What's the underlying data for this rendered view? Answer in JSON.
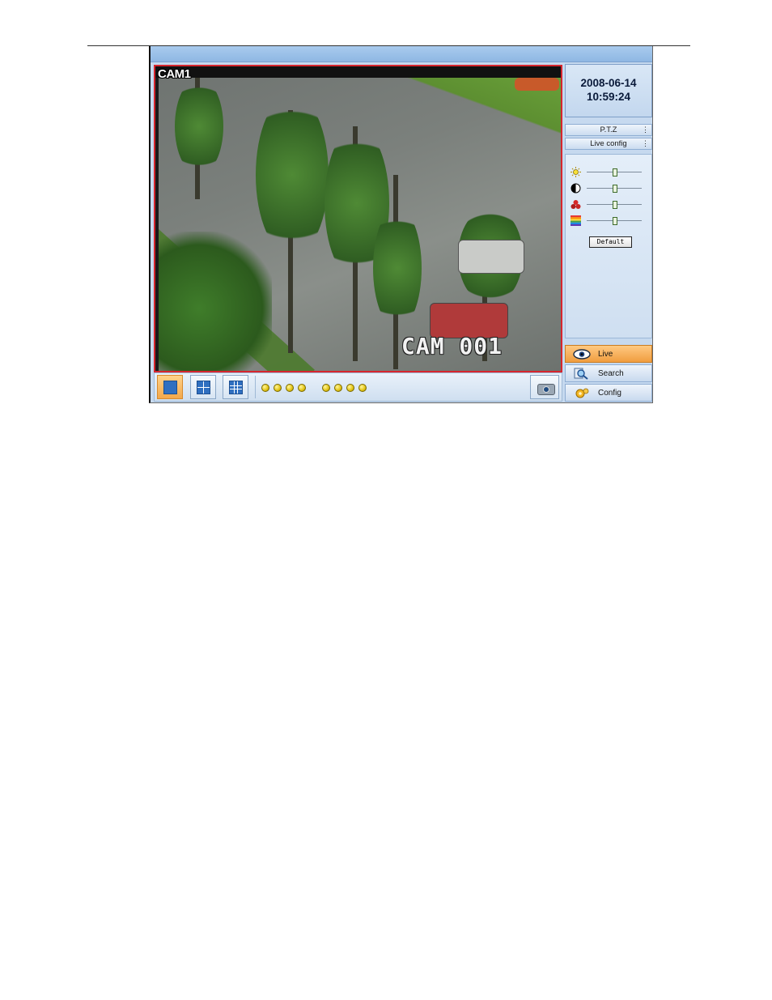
{
  "app": {
    "camera_name": "CAM1",
    "osd_text": "CAM 001",
    "datetime": {
      "date": "2008-06-14",
      "time": "10:59:24"
    },
    "tabs": [
      {
        "label": "P.T.Z"
      },
      {
        "label": "Live config"
      }
    ],
    "adjustments": [
      {
        "name": "brightness",
        "icon": "sun-icon",
        "value": 0.5
      },
      {
        "name": "contrast",
        "icon": "contrast-icon",
        "value": 0.5
      },
      {
        "name": "saturation",
        "icon": "color-balls-icon",
        "value": 0.5
      },
      {
        "name": "hue",
        "icon": "rainbow-icon",
        "value": 0.5
      }
    ],
    "default_label": "Default",
    "nav": [
      {
        "label": "Live",
        "icon": "eye-icon",
        "active": true
      },
      {
        "label": "Search",
        "icon": "magnifier-icon",
        "active": false
      },
      {
        "label": "Config",
        "icon": "gear-icon",
        "active": false
      }
    ],
    "layouts": [
      "single-view-icon",
      "quad-view-icon",
      "nine-view-icon"
    ],
    "channel_dot_count": 8,
    "colors": {
      "accent": "#f3a84b",
      "frame_border": "#d7262e",
      "panel": "#c6d9ef"
    }
  }
}
